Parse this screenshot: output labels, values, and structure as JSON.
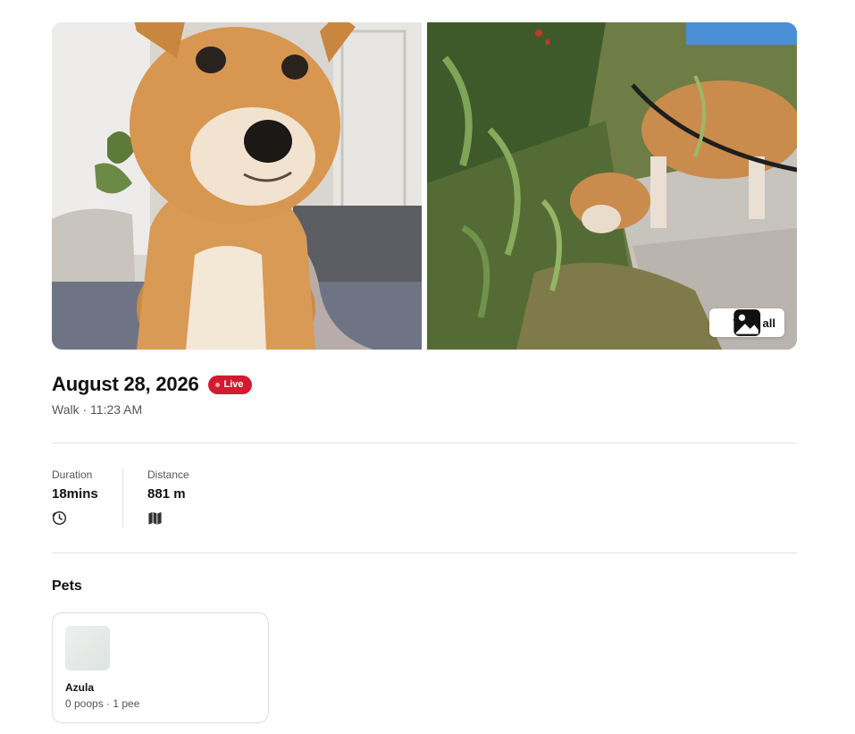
{
  "gallery": {
    "photos": [
      {
        "subject": "shiba inu dog close-up indoors"
      },
      {
        "subject": "shiba inu dog sniffing plants on sidewalk"
      }
    ],
    "view_all_label": "View all",
    "view_all_icon": "gallery-icon"
  },
  "header": {
    "title": "August 28, 2026",
    "live_label": "Live",
    "subtitle": "Walk · 11:23 AM"
  },
  "stats": [
    {
      "label": "Duration",
      "value": "18mins",
      "icon": "clock-icon"
    },
    {
      "label": "Distance",
      "value": "881 m",
      "icon": "map-icon"
    }
  ],
  "pets_section": {
    "title": "Pets",
    "pets": [
      {
        "name": "Azula",
        "summary": "0 poops · 1 pee"
      }
    ]
  },
  "colors": {
    "live_badge": "#d21a31",
    "divider": "#e2e2e2",
    "text_primary": "#111111",
    "text_secondary": "#555555"
  }
}
